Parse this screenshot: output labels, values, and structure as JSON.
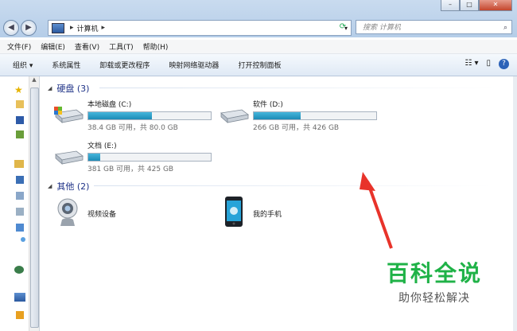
{
  "address": {
    "root_label": "计算机",
    "search_placeholder": "搜索 计算机"
  },
  "menu": [
    "文件(F)",
    "编辑(E)",
    "查看(V)",
    "工具(T)",
    "帮助(H)"
  ],
  "commands": [
    "组织 ▾",
    "系统属性",
    "卸载或更改程序",
    "映射网络驱动器",
    "打开控制面板"
  ],
  "groups": {
    "hard_disks": {
      "title": "硬盘 (3)"
    },
    "other": {
      "title": "其他 (2)"
    }
  },
  "drives": [
    {
      "name": "本地磁盘 (C:)",
      "space": "38.4 GB 可用，共 80.0 GB",
      "used_fraction": 0.52
    },
    {
      "name": "软件 (D:)",
      "space": "266 GB 可用，共 426 GB",
      "used_fraction": 0.38
    },
    {
      "name": "文档 (E:)",
      "space": "381 GB 可用，共 425 GB",
      "used_fraction": 0.1
    }
  ],
  "devices": [
    {
      "name": "视频设备",
      "icon": "webcam-icon"
    },
    {
      "name": "我的手机",
      "icon": "phone-icon"
    }
  ],
  "watermark": {
    "title": "百科全说",
    "subtitle": "助你轻松解决"
  },
  "colors": {
    "accent": "#1fb247",
    "arrow": "#e8332a",
    "bar_fill": "#2a9fcc"
  }
}
